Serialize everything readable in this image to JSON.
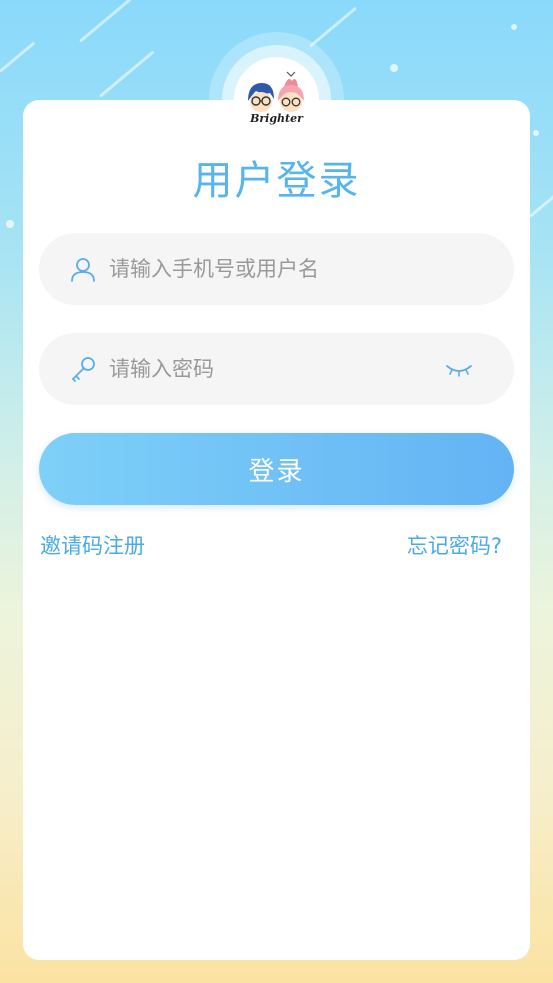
{
  "logo": {
    "brand_text": "Brighter",
    "icon": "couple-cartoon-logo"
  },
  "login": {
    "title": "用户登录",
    "username_placeholder": "请输入手机号或用户名",
    "password_placeholder": "请输入密码",
    "submit_label": "登录",
    "invite_register": "邀请码注册",
    "forgot_password": "忘记密码?"
  },
  "colors": {
    "accent": "#58b5ec",
    "button_start": "#7ed0f8",
    "button_end": "#64b3f4",
    "field_bg": "#f5f5f5",
    "link": "#4aaae6"
  }
}
